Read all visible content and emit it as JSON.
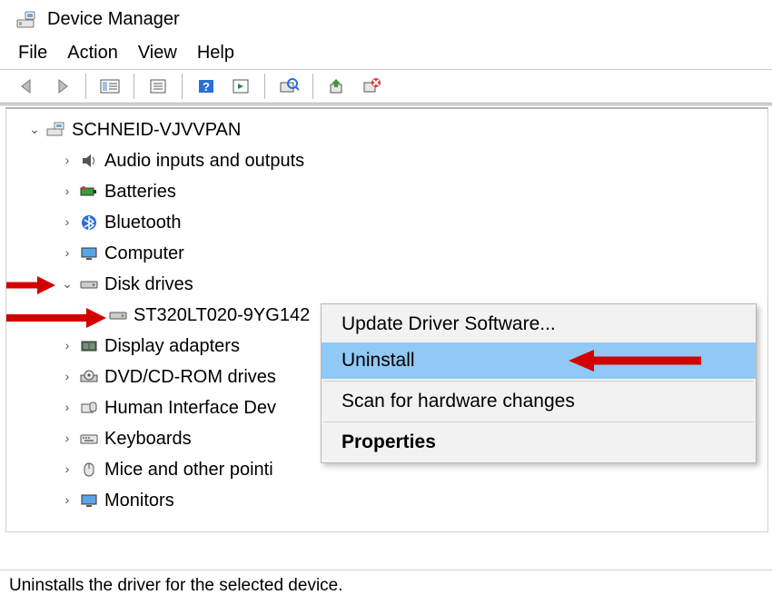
{
  "title": "Device Manager",
  "menu": {
    "file": "File",
    "action": "Action",
    "view": "View",
    "help": "Help"
  },
  "root": "SCHNEID-VJVVPAN",
  "nodes": {
    "audio": "Audio inputs and outputs",
    "batt": "Batteries",
    "bt": "Bluetooth",
    "comp": "Computer",
    "disk": "Disk drives",
    "diskdev": "ST320LT020-9YG142",
    "disp": "Display adapters",
    "dvd": "DVD/CD-ROM drives",
    "hid": "Human Interface Dev",
    "kbd": "Keyboards",
    "mice": "Mice and other pointi",
    "mon": "Monitors"
  },
  "context": {
    "update": "Update Driver Software...",
    "uninstall": "Uninstall",
    "scan": "Scan for hardware changes",
    "props": "Properties"
  },
  "status": "Uninstalls the driver for the selected device."
}
